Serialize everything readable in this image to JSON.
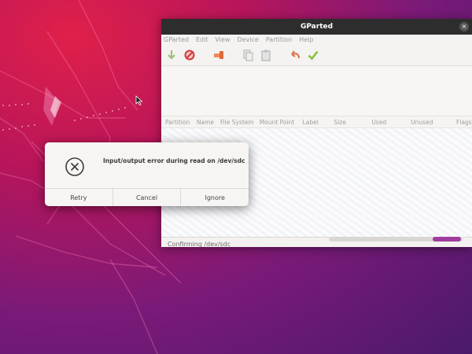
{
  "window": {
    "title": "GParted",
    "close_glyph": "×"
  },
  "menu": [
    "GParted",
    "Edit",
    "View",
    "Device",
    "Partition",
    "Help"
  ],
  "toolbar": {
    "icons": [
      "new-icon",
      "delete-icon",
      "resize-move-icon",
      "copy-icon",
      "paste-icon",
      "undo-icon",
      "apply-icon"
    ]
  },
  "partition_table": {
    "columns": [
      "Partition",
      "Name",
      "File System",
      "Mount Point",
      "Label",
      "Size",
      "Used",
      "Unused",
      "Flags"
    ]
  },
  "status": {
    "text": "Confirming /dev/sdc",
    "progress_visible": true
  },
  "dialog": {
    "message": "Input/output error during read on /dev/sdc",
    "icon": "error-x-icon",
    "buttons": [
      "Retry",
      "Cancel",
      "Ignore"
    ]
  },
  "colors": {
    "titlebar": "#2d2d2d",
    "progress": "#9f3c9f",
    "desktop_top": "#e0204a",
    "desktop_bottom": "#4a1a6a"
  }
}
